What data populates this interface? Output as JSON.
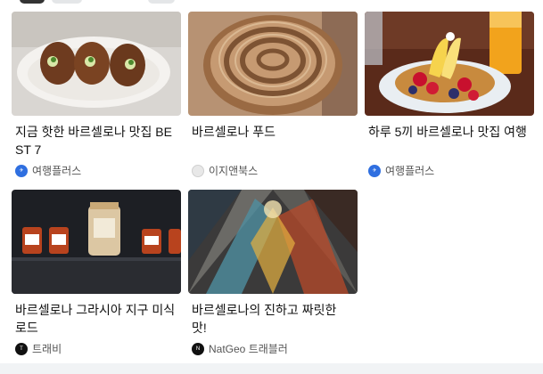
{
  "cards": [
    {
      "title": "지금 핫한 바르셀로나 맛집 BEST 7",
      "source": "여행플러스",
      "source_icon": "travelplus-logo-icon",
      "source_color": "#2f6fe0"
    },
    {
      "title": "바르셀로나 푸드",
      "source": "이지앤북스",
      "source_icon": "easybooks-logo-icon",
      "source_color": "#e8e8e8"
    },
    {
      "title": "하루 5끼 바르셀로나 맛집 여행",
      "source": "여행플러스",
      "source_icon": "travelplus-logo-icon",
      "source_color": "#2f6fe0"
    },
    {
      "title": "바르셀로나 그라시아 지구 미식 로드",
      "source": "트래비",
      "source_icon": "travie-logo-icon",
      "source_color": "#111111"
    },
    {
      "title": "바르셀로나의 진하고 짜릿한 맛!",
      "source": "NatGeo 트래블러",
      "source_icon": "natgeo-logo-icon",
      "source_color": "#111111"
    }
  ]
}
